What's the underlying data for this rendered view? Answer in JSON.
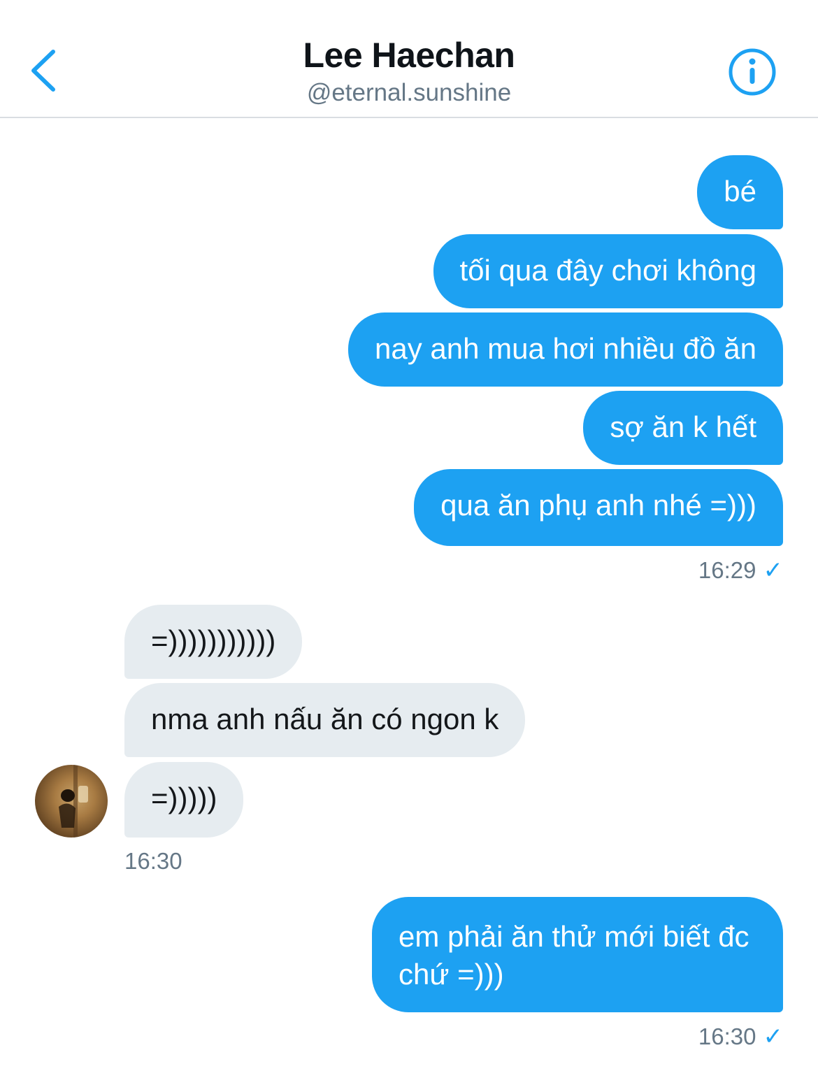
{
  "header": {
    "title": "Lee Haechan",
    "handle": "@eternal.sunshine"
  },
  "messages": {
    "group1": [
      "bé",
      "tối qua đây chơi không",
      "nay anh mua hơi nhiều đồ ăn",
      "sợ ăn k hết",
      "qua ăn phụ anh nhé =)))"
    ],
    "group1_time": "16:29",
    "group2": [
      "=)))))))))))",
      "nma anh nấu ăn có ngon k",
      "=)))))"
    ],
    "group2_time": "16:30",
    "group3": [
      "em phải ăn thử mới biết đc chứ =)))"
    ],
    "group3_time": "16:30"
  },
  "colors": {
    "accent": "#1da1f2",
    "incoming_bubble": "#e6ecf0",
    "secondary_text": "#657786"
  },
  "icons": {
    "back": "chevron-left-icon",
    "info": "info-icon",
    "read": "check-icon"
  }
}
